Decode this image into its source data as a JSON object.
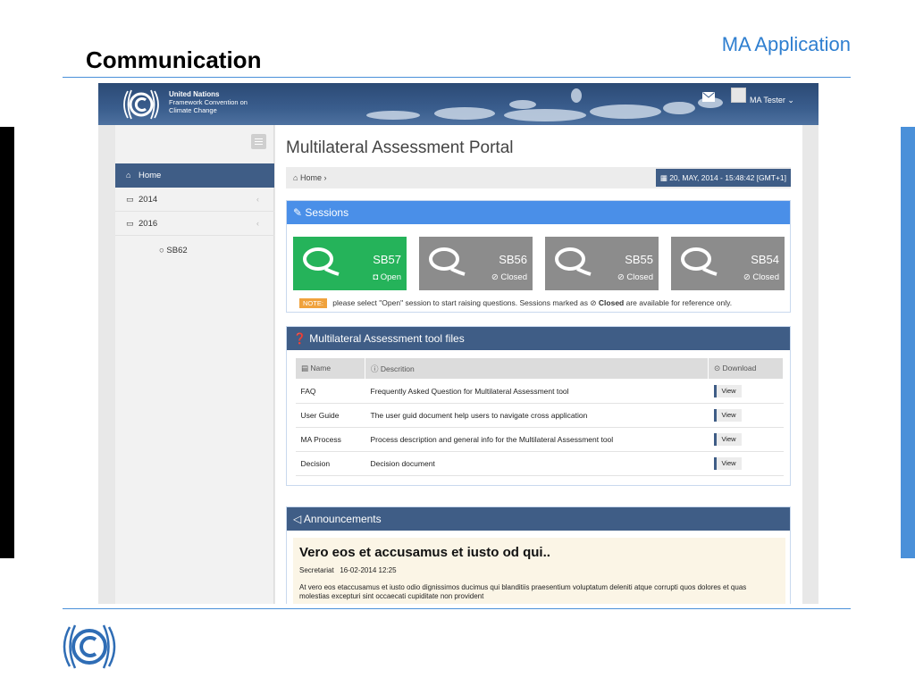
{
  "slide": {
    "title": "Communication",
    "subtitle": "MA Application"
  },
  "app": {
    "org_name": "United Nations",
    "org_sub1": "Framework Convention on",
    "org_sub2": "Climate Change",
    "user_name": "MA Tester",
    "user_caret": "⌄",
    "page_title": "Multilateral Assessment Portal",
    "breadcrumb_home": "Home",
    "breadcrumb_sep": "›",
    "datetime": "20, MAY, 2014 - 15:48:42 [GMT+1]"
  },
  "sidebar": {
    "items": [
      {
        "icon": "home-icon",
        "label": "Home",
        "active": true
      },
      {
        "icon": "folder-icon",
        "label": "2014",
        "chevron": "‹"
      },
      {
        "icon": "folder-icon",
        "label": "2016",
        "chevron": "‹"
      }
    ],
    "sub_item": "SB62"
  },
  "sessions": {
    "heading": "Sessions",
    "tiles": [
      {
        "code": "SB57",
        "state": "Open",
        "status": "open"
      },
      {
        "code": "SB56",
        "state": "Closed",
        "status": "closed"
      },
      {
        "code": "SB55",
        "state": "Closed",
        "status": "closed"
      },
      {
        "code": "SB54",
        "state": "Closed",
        "status": "closed"
      }
    ],
    "note_tag": "NOTE:",
    "note_before": "please select \"Open\" session to start raising questions. Sessions marked as",
    "note_bold": "Closed",
    "note_after": "are available for reference only."
  },
  "files": {
    "heading": "Multilateral Assessment tool files",
    "columns": [
      "Name",
      "Descrition",
      "Download"
    ],
    "rows": [
      {
        "name": "FAQ",
        "description": "Frequently Asked Question for Multilateral Assessment tool",
        "action": "View"
      },
      {
        "name": "User Guide",
        "description": "The user guid document help users to navigate cross application",
        "action": "View"
      },
      {
        "name": "MA Process",
        "description": "Process description and general info for the Multilateral Assessment tool",
        "action": "View"
      },
      {
        "name": "Decision",
        "description": "Decision document",
        "action": "View"
      }
    ]
  },
  "announcements": {
    "heading": "Announcements",
    "title": "Vero eos et accusamus et iusto od qui..",
    "author": "Secretariat",
    "date": "16-02-2014 12:25",
    "body": "At vero eos etaccusamus et iusto odio dignissimos ducimus qui blanditiis praesentium voluptatum deleniti atque corrupti quos dolores et quas molestias excepturi sint occaecati cupiditate non provident"
  },
  "colors": {
    "accent": "#4a8fe8",
    "navy": "#3f5d86",
    "open": "#25b35a",
    "closed": "#8c8c8c",
    "note": "#f0a23c"
  }
}
